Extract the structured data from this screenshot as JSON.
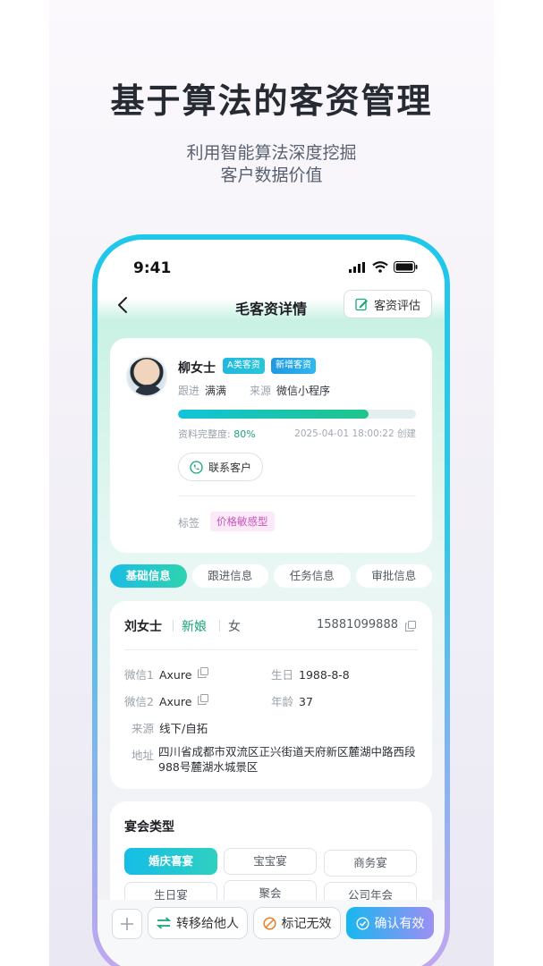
{
  "promo": {
    "headline": "基于算法的客资管理",
    "subline_1": "利用智能算法深度挖掘",
    "subline_2": "客户数据价值"
  },
  "status_bar": {
    "time": "9:41"
  },
  "nav": {
    "title": "毛客资详情",
    "eval_button": "客资评估"
  },
  "profile": {
    "name": "柳女士",
    "tags": [
      "A类客资",
      "新增客资"
    ],
    "follow_label": "跟进",
    "follow_value": "满满",
    "source_label": "来源",
    "source_value": "微信小程序",
    "completeness_label": "资料完整度:",
    "completeness_value": "80%",
    "completeness_fraction": 0.8,
    "created": "2025-04-01 18:00:22 创建",
    "contact_button": "联系客户",
    "labels_title": "标签",
    "label_chip": "价格敏感型"
  },
  "tabs": [
    {
      "label": "基础信息",
      "active": true
    },
    {
      "label": "跟进信息",
      "active": false
    },
    {
      "label": "任务信息",
      "active": false
    },
    {
      "label": "审批信息",
      "active": false
    }
  ],
  "basic_info": {
    "name": "刘女士",
    "role": "新娘",
    "gender": "女",
    "phone": "15881099888",
    "wechat1_label": "微信1",
    "wechat1_value": "Axure",
    "wechat2_label": "微信2",
    "wechat2_value": "Axure",
    "birthday_label": "生日",
    "birthday_value": "1988-8-8",
    "age_label": "年龄",
    "age_value": "37",
    "source_label": "来源",
    "source_value": "线下/自拓",
    "address_label": "地址",
    "address_value": "四川省成都市双流区正兴街道天府新区麓湖中路西段988号麓湖水城景区"
  },
  "banquet": {
    "title": "宴会类型",
    "options": [
      {
        "label": "婚庆喜宴",
        "active": true
      },
      {
        "label": "宝宝宴",
        "active": false
      },
      {
        "label": "商务宴",
        "active": false
      },
      {
        "label": "生日宴",
        "active": false
      },
      {
        "label": "聚会",
        "active": false
      },
      {
        "label": "公司年会",
        "active": false
      }
    ]
  },
  "actions": {
    "transfer": "转移给他人",
    "mark_invalid": "标记无效",
    "confirm_valid": "确认有效"
  },
  "colors": {
    "accent_cyan": "#1fc7ea",
    "accent_green": "#17a673",
    "accent_purple": "#c4a6f0",
    "label_pink": "#c557b8"
  }
}
